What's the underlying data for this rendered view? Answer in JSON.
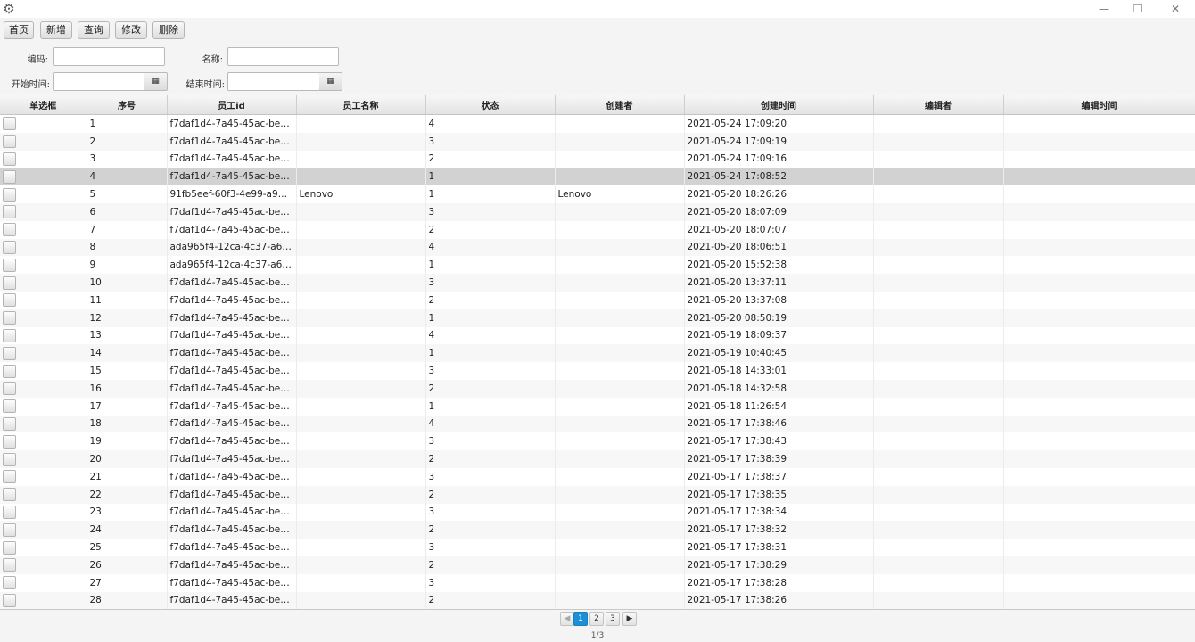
{
  "window": {
    "icon": "gear-icon",
    "minimize_glyph": "—",
    "restore_glyph": "❐",
    "close_glyph": "✕"
  },
  "toolbar": {
    "home": "首页",
    "add": "新增",
    "query": "查询",
    "edit": "修改",
    "delete": "删除"
  },
  "filters": {
    "code_label": "编码:",
    "code_value": "",
    "name_label": "名称:",
    "name_value": "",
    "start_label": "开始时间:",
    "start_value": "",
    "end_label": "结束时间:",
    "end_value": "",
    "calendar_glyph": "▦"
  },
  "table": {
    "columns": [
      "单选框",
      "序号",
      "员工id",
      "员工名称",
      "状态",
      "创建者",
      "创建时间",
      "编辑者",
      "编辑时间"
    ],
    "selected_row": 4,
    "rows": [
      {
        "seq": "1",
        "emp_id": "f7daf1d4-7a45-45ac-be8...",
        "emp_name": "",
        "status": "4",
        "creator": "",
        "created": "2021-05-24 17:09:20",
        "editor": "",
        "edited": ""
      },
      {
        "seq": "2",
        "emp_id": "f7daf1d4-7a45-45ac-be8...",
        "emp_name": "",
        "status": "3",
        "creator": "",
        "created": "2021-05-24 17:09:19",
        "editor": "",
        "edited": ""
      },
      {
        "seq": "3",
        "emp_id": "f7daf1d4-7a45-45ac-be8...",
        "emp_name": "",
        "status": "2",
        "creator": "",
        "created": "2021-05-24 17:09:16",
        "editor": "",
        "edited": ""
      },
      {
        "seq": "4",
        "emp_id": "f7daf1d4-7a45-45ac-be8...",
        "emp_name": "",
        "status": "1",
        "creator": "",
        "created": "2021-05-24 17:08:52",
        "editor": "",
        "edited": ""
      },
      {
        "seq": "5",
        "emp_id": "91fb5eef-60f3-4e99-a971...",
        "emp_name": "Lenovo",
        "status": "1",
        "creator": "Lenovo",
        "created": "2021-05-20 18:26:26",
        "editor": "",
        "edited": ""
      },
      {
        "seq": "6",
        "emp_id": "f7daf1d4-7a45-45ac-be8...",
        "emp_name": "",
        "status": "3",
        "creator": "",
        "created": "2021-05-20 18:07:09",
        "editor": "",
        "edited": ""
      },
      {
        "seq": "7",
        "emp_id": "f7daf1d4-7a45-45ac-be8...",
        "emp_name": "",
        "status": "2",
        "creator": "",
        "created": "2021-05-20 18:07:07",
        "editor": "",
        "edited": ""
      },
      {
        "seq": "8",
        "emp_id": "ada965f4-12ca-4c37-a6d...",
        "emp_name": "",
        "status": "4",
        "creator": "",
        "created": "2021-05-20 18:06:51",
        "editor": "",
        "edited": ""
      },
      {
        "seq": "9",
        "emp_id": "ada965f4-12ca-4c37-a6d...",
        "emp_name": "",
        "status": "1",
        "creator": "",
        "created": "2021-05-20 15:52:38",
        "editor": "",
        "edited": ""
      },
      {
        "seq": "10",
        "emp_id": "f7daf1d4-7a45-45ac-be8...",
        "emp_name": "",
        "status": "3",
        "creator": "",
        "created": "2021-05-20 13:37:11",
        "editor": "",
        "edited": ""
      },
      {
        "seq": "11",
        "emp_id": "f7daf1d4-7a45-45ac-be8...",
        "emp_name": "",
        "status": "2",
        "creator": "",
        "created": "2021-05-20 13:37:08",
        "editor": "",
        "edited": ""
      },
      {
        "seq": "12",
        "emp_id": "f7daf1d4-7a45-45ac-be8...",
        "emp_name": "",
        "status": "1",
        "creator": "",
        "created": "2021-05-20 08:50:19",
        "editor": "",
        "edited": ""
      },
      {
        "seq": "13",
        "emp_id": "f7daf1d4-7a45-45ac-be8...",
        "emp_name": "",
        "status": "4",
        "creator": "",
        "created": "2021-05-19 18:09:37",
        "editor": "",
        "edited": ""
      },
      {
        "seq": "14",
        "emp_id": "f7daf1d4-7a45-45ac-be8...",
        "emp_name": "",
        "status": "1",
        "creator": "",
        "created": "2021-05-19 10:40:45",
        "editor": "",
        "edited": ""
      },
      {
        "seq": "15",
        "emp_id": "f7daf1d4-7a45-45ac-be8...",
        "emp_name": "",
        "status": "3",
        "creator": "",
        "created": "2021-05-18 14:33:01",
        "editor": "",
        "edited": ""
      },
      {
        "seq": "16",
        "emp_id": "f7daf1d4-7a45-45ac-be8...",
        "emp_name": "",
        "status": "2",
        "creator": "",
        "created": "2021-05-18 14:32:58",
        "editor": "",
        "edited": ""
      },
      {
        "seq": "17",
        "emp_id": "f7daf1d4-7a45-45ac-be8...",
        "emp_name": "",
        "status": "1",
        "creator": "",
        "created": "2021-05-18 11:26:54",
        "editor": "",
        "edited": ""
      },
      {
        "seq": "18",
        "emp_id": "f7daf1d4-7a45-45ac-be8...",
        "emp_name": "",
        "status": "4",
        "creator": "",
        "created": "2021-05-17 17:38:46",
        "editor": "",
        "edited": ""
      },
      {
        "seq": "19",
        "emp_id": "f7daf1d4-7a45-45ac-be8...",
        "emp_name": "",
        "status": "3",
        "creator": "",
        "created": "2021-05-17 17:38:43",
        "editor": "",
        "edited": ""
      },
      {
        "seq": "20",
        "emp_id": "f7daf1d4-7a45-45ac-be8...",
        "emp_name": "",
        "status": "2",
        "creator": "",
        "created": "2021-05-17 17:38:39",
        "editor": "",
        "edited": ""
      },
      {
        "seq": "21",
        "emp_id": "f7daf1d4-7a45-45ac-be8...",
        "emp_name": "",
        "status": "3",
        "creator": "",
        "created": "2021-05-17 17:38:37",
        "editor": "",
        "edited": ""
      },
      {
        "seq": "22",
        "emp_id": "f7daf1d4-7a45-45ac-be8...",
        "emp_name": "",
        "status": "2",
        "creator": "",
        "created": "2021-05-17 17:38:35",
        "editor": "",
        "edited": ""
      },
      {
        "seq": "23",
        "emp_id": "f7daf1d4-7a45-45ac-be8...",
        "emp_name": "",
        "status": "3",
        "creator": "",
        "created": "2021-05-17 17:38:34",
        "editor": "",
        "edited": ""
      },
      {
        "seq": "24",
        "emp_id": "f7daf1d4-7a45-45ac-be8...",
        "emp_name": "",
        "status": "2",
        "creator": "",
        "created": "2021-05-17 17:38:32",
        "editor": "",
        "edited": ""
      },
      {
        "seq": "25",
        "emp_id": "f7daf1d4-7a45-45ac-be8...",
        "emp_name": "",
        "status": "3",
        "creator": "",
        "created": "2021-05-17 17:38:31",
        "editor": "",
        "edited": ""
      },
      {
        "seq": "26",
        "emp_id": "f7daf1d4-7a45-45ac-be8...",
        "emp_name": "",
        "status": "2",
        "creator": "",
        "created": "2021-05-17 17:38:29",
        "editor": "",
        "edited": ""
      },
      {
        "seq": "27",
        "emp_id": "f7daf1d4-7a45-45ac-be8...",
        "emp_name": "",
        "status": "3",
        "creator": "",
        "created": "2021-05-17 17:38:28",
        "editor": "",
        "edited": ""
      },
      {
        "seq": "28",
        "emp_id": "f7daf1d4-7a45-45ac-be8...",
        "emp_name": "",
        "status": "2",
        "creator": "",
        "created": "2021-05-17 17:38:26",
        "editor": "",
        "edited": ""
      }
    ]
  },
  "pagination": {
    "prev_glyph": "◀",
    "next_glyph": "▶",
    "pages": [
      "1",
      "2",
      "3"
    ],
    "current": "1",
    "info": "1/3",
    "active_color": "#1c8fd6"
  }
}
